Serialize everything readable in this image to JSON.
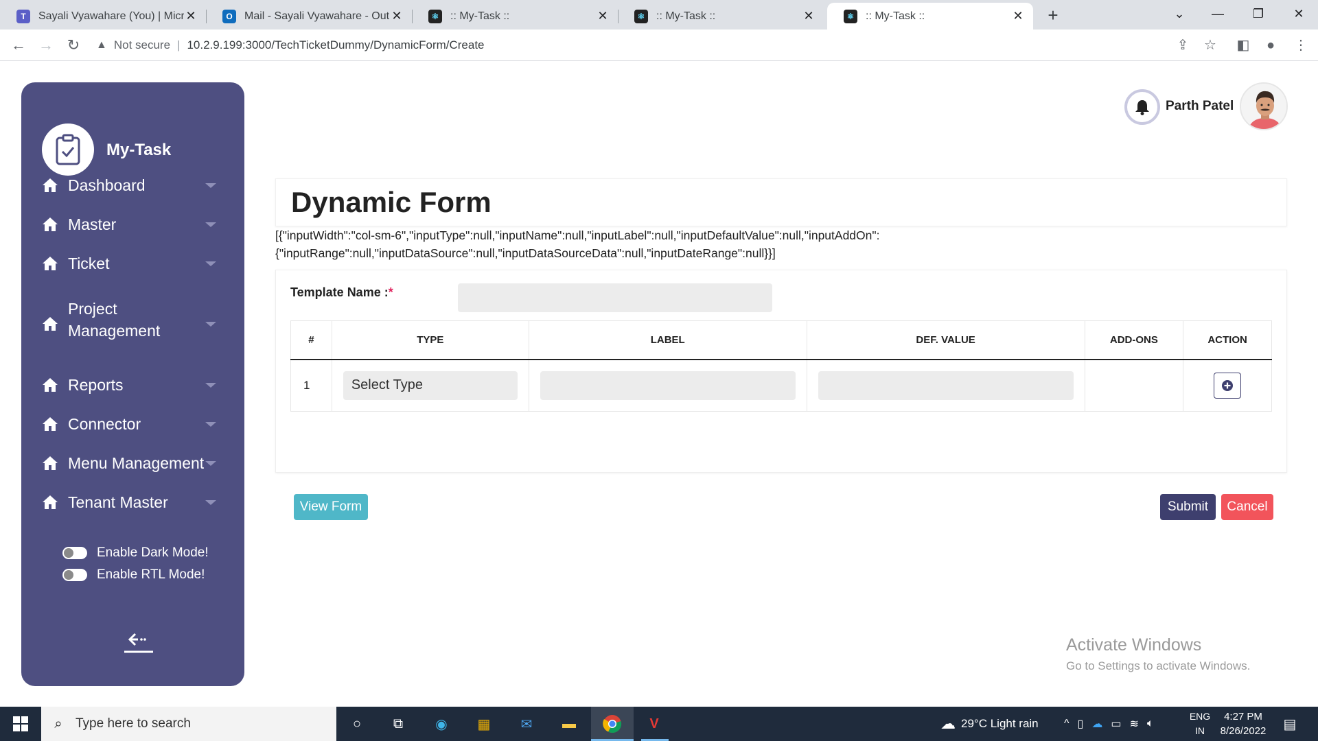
{
  "browser": {
    "tabs": [
      {
        "title": "Sayali Vyawahare (You) | Microso"
      },
      {
        "title": "Mail - Sayali Vyawahare - Outloo"
      },
      {
        "title": ":: My-Task ::"
      },
      {
        "title": ":: My-Task ::"
      },
      {
        "title": ":: My-Task ::"
      }
    ],
    "security_label": "Not secure",
    "url": "10.2.9.199:3000/TechTicketDummy/DynamicForm/Create"
  },
  "sidebar": {
    "brand": "My-Task",
    "items": [
      {
        "label": "Dashboard"
      },
      {
        "label": "Master"
      },
      {
        "label": "Ticket"
      },
      {
        "label": "Project Management"
      },
      {
        "label": "Reports"
      },
      {
        "label": "Connector"
      },
      {
        "label": "Menu Management"
      },
      {
        "label": "Tenant Master"
      }
    ],
    "toggles": [
      {
        "label": "Enable Dark Mode!",
        "on": false
      },
      {
        "label": "Enable RTL Mode!",
        "on": false
      }
    ]
  },
  "header": {
    "user_name": "Parth Patel"
  },
  "main": {
    "title": "Dynamic Form",
    "json_line1": "[{\"inputWidth\":\"col-sm-6\",\"inputType\":null,\"inputName\":null,\"inputLabel\":null,\"inputDefaultValue\":null,\"inputAddOn\":",
    "json_line2": "{\"inputRange\":null,\"inputDataSource\":null,\"inputDataSourceData\":null,\"inputDateRange\":null}}]",
    "template_label": "Template Name :",
    "template_required": "*",
    "template_value": "",
    "table": {
      "headers": [
        "#",
        "TYPE",
        "LABEL",
        "DEF. VALUE",
        "ADD-ONS",
        "ACTION"
      ],
      "rows": [
        {
          "num": "1",
          "type": "Select Type",
          "label": "",
          "def_value": "",
          "addons": ""
        }
      ]
    },
    "buttons": {
      "view_form": "View Form",
      "submit": "Submit",
      "cancel": "Cancel"
    }
  },
  "watermark": {
    "line1": "Activate Windows",
    "line2": "Go to Settings to activate Windows."
  },
  "taskbar": {
    "search_placeholder": "Type here to search",
    "weather": "29°C  Light rain",
    "lang_line1": "ENG",
    "lang_line2": "IN",
    "time": "4:27 PM",
    "date": "8/26/2022"
  },
  "colors": {
    "sidebar_bg": "#4e4f81",
    "submit_bg": "#3e3f6e",
    "view_form_bg": "#4fb7c8",
    "cancel_bg": "#f2545b"
  }
}
